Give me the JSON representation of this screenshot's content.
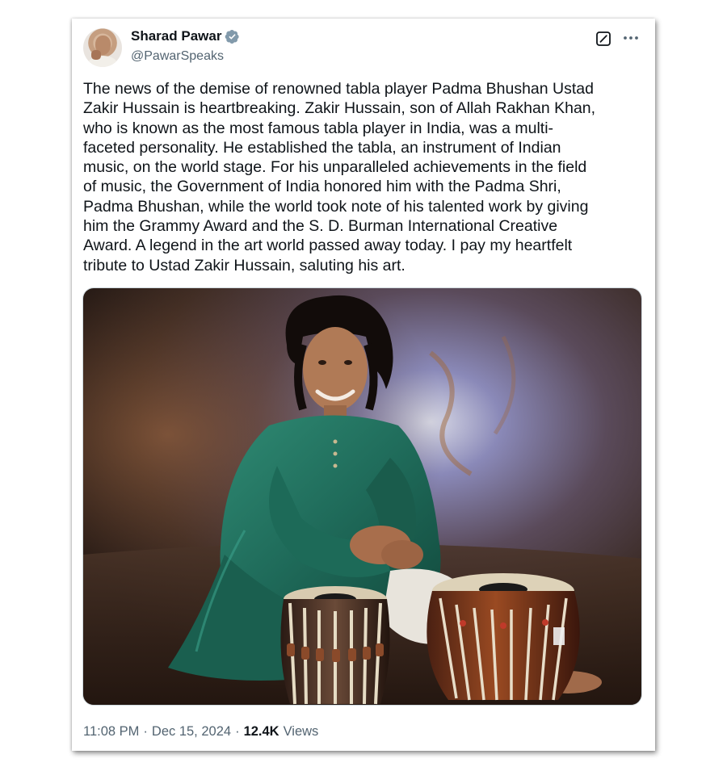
{
  "author": {
    "name": "Sharad Pawar",
    "handle": "@PawarSpeaks",
    "verified": true
  },
  "icons": {
    "verified": "verified-badge-icon",
    "grok": "grok-icon",
    "more": "more-options-icon"
  },
  "tweet": {
    "text": "The news of the demise of renowned tabla player Padma Bhushan Ustad\nZakir Hussain is heartbreaking. Zakir Hussain, son of Allah Rakhan Khan,\nwho is known as the most famous tabla player in India, was a multi-\nfaceted personality. He established the tabla, an instrument of Indian\nmusic, on the world stage. For his unparalleled achievements in the field\nof music, the Government of India honored him with the Padma Shri,\nPadma Bhushan, while the world took note of his talented work by giving\nhim the Grammy Award and the S. D. Burman International Creative\nAward. A legend in the art world passed away today. I pay my heartfelt\ntribute to Ustad Zakir Hussain, saluting his art.",
    "time": "11:08 PM",
    "separator": "·",
    "date": "Dec 15, 2024",
    "views_count": "12.4K",
    "views_label": "Views"
  },
  "colors": {
    "text": "#0f1419",
    "secondary": "#536471",
    "verified": "#829aab",
    "kurta": "#1f6b5a"
  }
}
